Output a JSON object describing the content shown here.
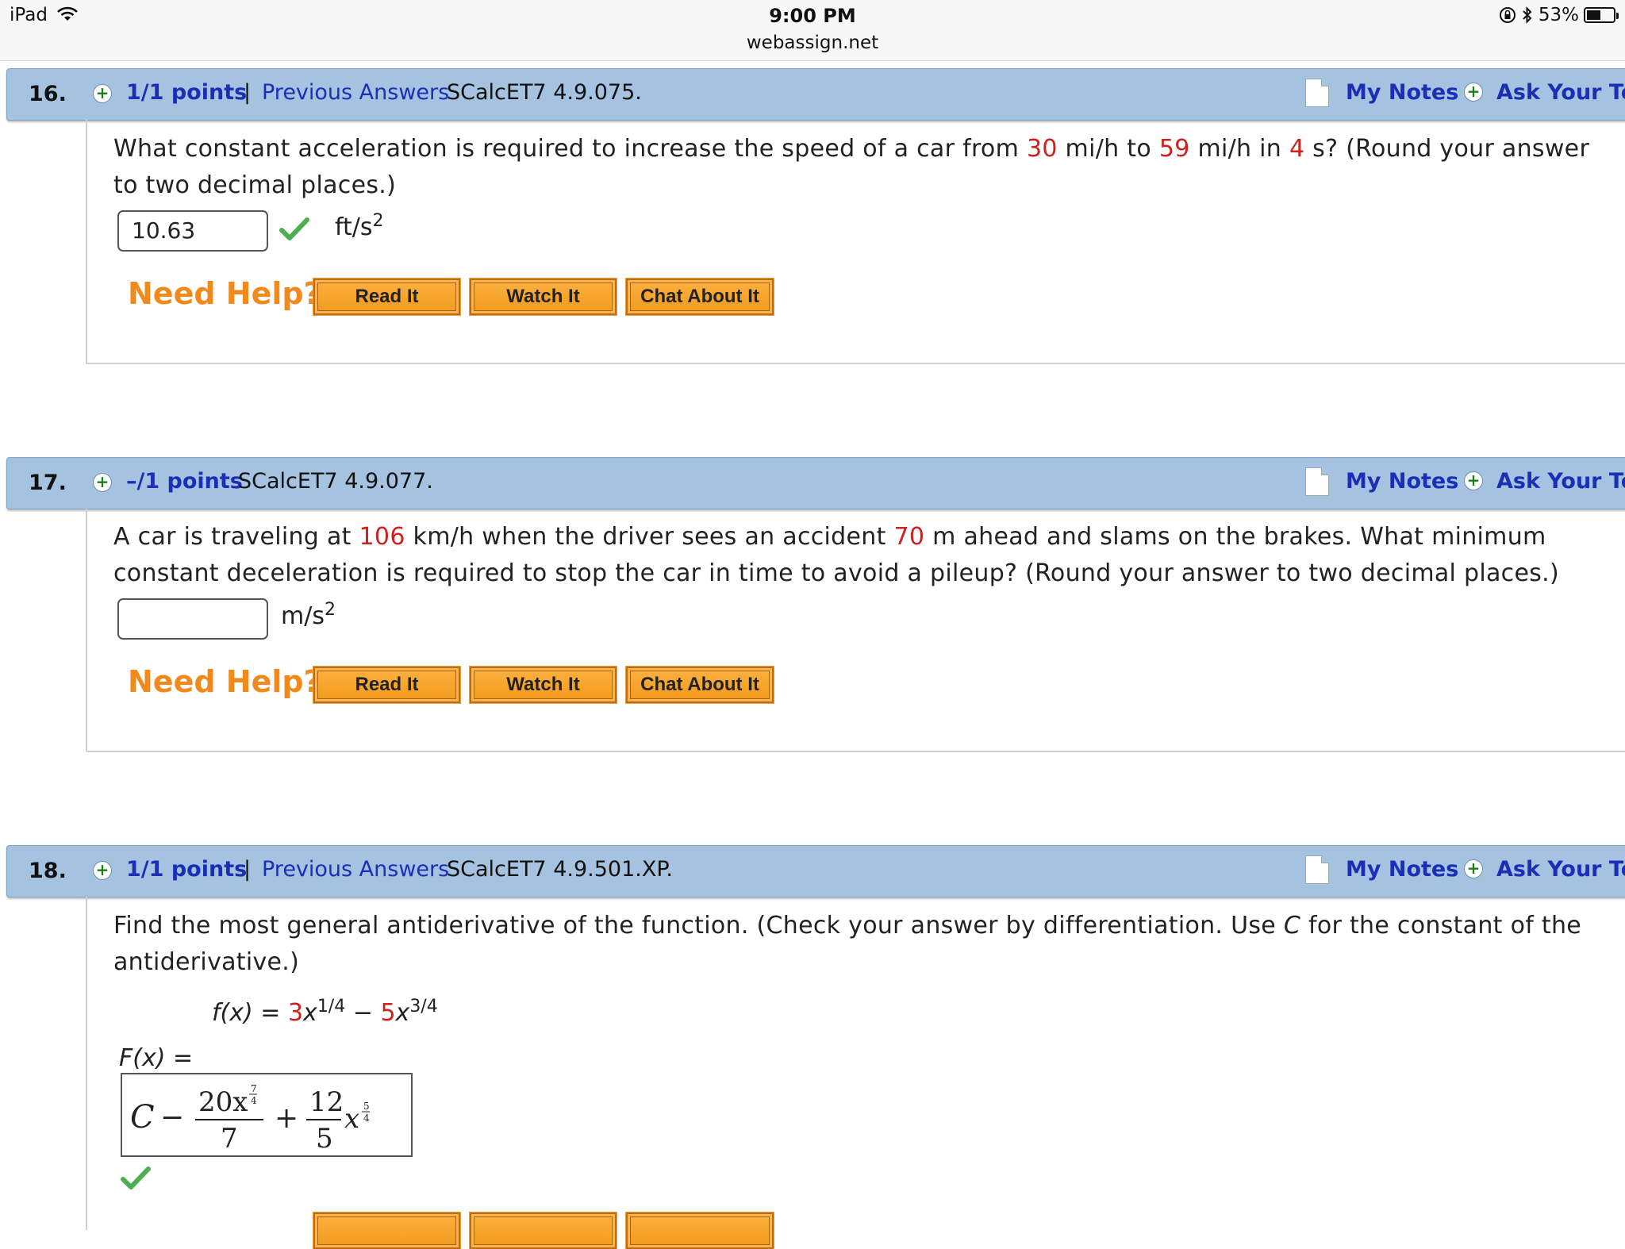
{
  "status": {
    "device": "iPad",
    "time": "9:00 PM",
    "url": "webassign.net",
    "battery": "53%",
    "battery_level": 0.53
  },
  "header_links": {
    "my_notes": "My Notes",
    "ask_teacher": "Ask Your Tea"
  },
  "questions": [
    {
      "number": "16.",
      "points": "1/1 points",
      "separator": "|",
      "previous_answers": "Previous Answers",
      "reference": "SCalcET7 4.9.075.",
      "text_parts": [
        "What constant acceleration is required to increase the speed of a car from ",
        "30",
        " mi/h to ",
        "59",
        " mi/h in ",
        "4",
        " s? (Round your answer to two decimal places.)"
      ],
      "answer": "10.63",
      "unit": "ft/s",
      "unit_exp": "2",
      "correct": true
    },
    {
      "number": "17.",
      "points": "–/1 points",
      "reference": "SCalcET7 4.9.077.",
      "text_parts": [
        "A car is traveling at ",
        "106",
        " km/h when the driver sees an accident ",
        "70",
        " m ahead and slams on the brakes. What minimum constant deceleration is required to stop the car in time to avoid a pileup? (Round your answer to two decimal places.)"
      ],
      "answer": "",
      "unit": "m/s",
      "unit_exp": "2"
    },
    {
      "number": "18.",
      "points": "1/1 points",
      "separator": "|",
      "previous_answers": "Previous Answers",
      "reference": "SCalcET7 4.9.501.XP.",
      "text_parts": [
        "Find the most general antiderivative of the function. (Check your answer by differentiation. Use ",
        "C",
        " for the constant of the antiderivative.)"
      ],
      "function": {
        "lhs": "f(x) =",
        "coef1": "3",
        "var1": "x",
        "exp1": "1/4",
        "minus": "−",
        "coef2": "5",
        "var2": "x",
        "exp2": "3/4"
      },
      "F_label": "F(x) =",
      "math_answer": {
        "c": "C",
        "minus": "−",
        "num1": "20x",
        "exp1_num": "7",
        "exp1_den": "4",
        "den1": "7",
        "plus": "+",
        "num2": "12",
        "den2": "5",
        "var2": "x",
        "exp2_num": "5",
        "exp2_den": "4"
      },
      "correct": true
    }
  ],
  "help": {
    "label": "Need Help?",
    "read": "Read It",
    "watch": "Watch It",
    "chat": "Chat About It"
  },
  "colors": {
    "header_bar": "#a5c3e0",
    "link_blue": "#1a2fb5",
    "value_red": "#d0201e",
    "help_orange": "#f08a1c",
    "button_orange": "#f5a22a",
    "check_green": "#4caf50"
  }
}
